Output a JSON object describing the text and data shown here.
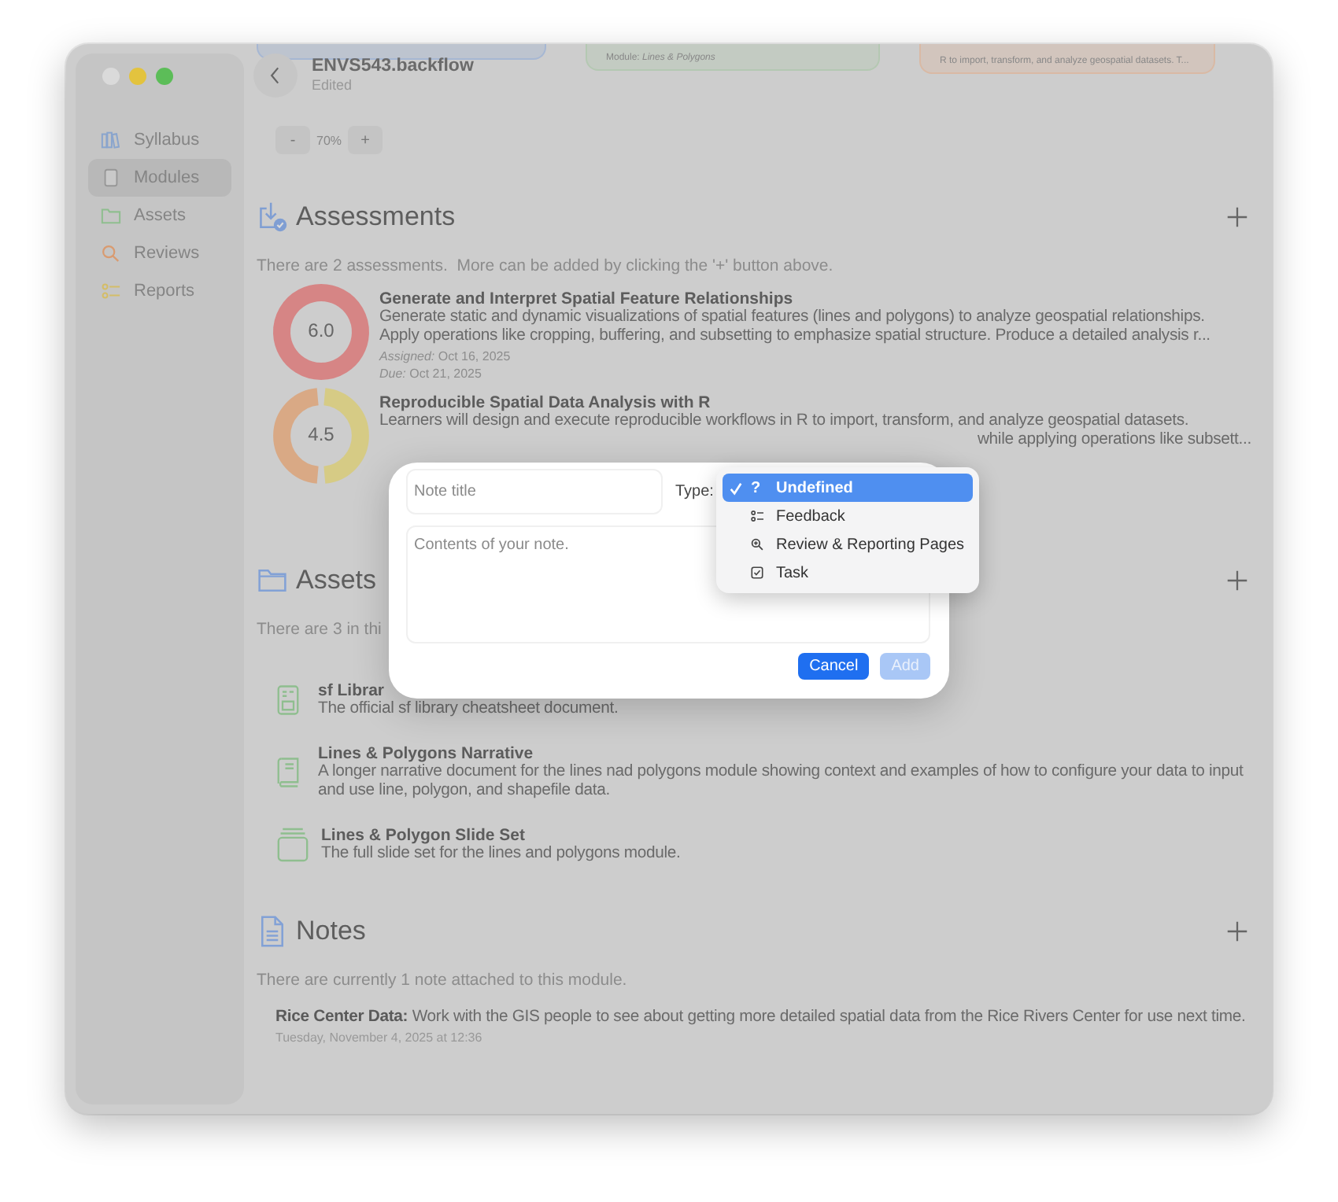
{
  "sidebar": {
    "items": [
      {
        "label": "Syllabus",
        "kind": "syllabus",
        "selected": false
      },
      {
        "label": "Modules",
        "kind": "modules",
        "selected": true
      },
      {
        "label": "Assets",
        "kind": "assets",
        "selected": false
      },
      {
        "label": "Reviews",
        "kind": "reviews",
        "selected": false
      },
      {
        "label": "Reports",
        "kind": "reports",
        "selected": false
      }
    ]
  },
  "top_cards": [
    {
      "color": "#a6b7d3"
    },
    {
      "color": "#b4c8b2",
      "text": "Module: *Lines & Polygons*"
    },
    {
      "color": "#d9b9a4",
      "text": "R to import, transform, and analyze geospatial datasets. T..."
    }
  ],
  "document": {
    "title": "ENVS543.backflow",
    "status": "Edited"
  },
  "zoom": {
    "decrease": "-",
    "value": "70%",
    "increase": "+"
  },
  "assessments": {
    "title": "Assessments",
    "summary": "There are 2 assessments.  More can be added by clicking the '+' button above.",
    "items": [
      {
        "score": "6.0",
        "ring": [
          {
            "color": "#d68585"
          }
        ],
        "title": "Generate and Interpret Spatial Feature Relationships",
        "lines": [
          {
            "left": "Generate static and dynamic visualizations of spatial features (lines and polygons) to analyze geospatial relationships."
          },
          {
            "left": "Apply operations like cropping, buffering, and subsetting to emphasize spatial structure. Produce a detailed analysis r..."
          }
        ],
        "assigned_label": "Assigned:",
        "assigned": "Oct 16, 2025",
        "due_label": "Due:",
        "due": "Oct 21, 2025"
      },
      {
        "score": "4.5",
        "ring": [
          {
            "color": "#d6cb85"
          },
          {
            "color": "#d9a985"
          }
        ],
        "title": "Reproducible Spatial Data Analysis with R",
        "lines": [
          {
            "left": "Learners will design and execute reproducible workflows in R to import, transform, and analyze geospatial datasets."
          },
          {
            "right": "while applying operations like subsett..."
          }
        ]
      }
    ]
  },
  "assets": {
    "title": "Assets",
    "summary": "There are 3 in thi",
    "items": [
      {
        "kind": "document",
        "title": "sf Librar",
        "text": "The official sf library cheatsheet document."
      },
      {
        "kind": "book",
        "title": "Lines & Polygons Narrative",
        "text": "A longer narrative document for the lines nad polygons module showing context and examples of how to configure your data to input and use line, polygon, and shapefile data."
      },
      {
        "kind": "slides",
        "title": "Lines & Polygon Slide Set",
        "text": "The full slide set for the lines and polygons module."
      }
    ]
  },
  "notes": {
    "title": "Notes",
    "summary": "There are currently 1 note attached to this module.",
    "items": [
      {
        "text": "**Rice Center Data:** Work with the GIS people to see about getting more detailed spatial data from the Rice Rivers Center for use next time.",
        "date": "Tuesday, November 4, 2025 at 12:36"
      }
    ]
  },
  "dialog": {
    "title_field": {
      "placeholder": "Note title"
    },
    "type_label": "Type:",
    "content_field": {
      "placeholder": "Contents of your note."
    },
    "type_menu": {
      "items": [
        {
          "label": "Undefined",
          "kind": "question",
          "glyph": "?",
          "selected": true
        },
        {
          "label": "Feedback",
          "kind": "feedback",
          "selected": false
        },
        {
          "label": "Review & Reporting Pages",
          "kind": "review",
          "selected": false
        },
        {
          "label": "Task",
          "kind": "task",
          "selected": false
        }
      ]
    },
    "buttons": [
      {
        "label": "Cancel",
        "disabled": false
      },
      {
        "label": "Add",
        "disabled": true
      }
    ]
  }
}
